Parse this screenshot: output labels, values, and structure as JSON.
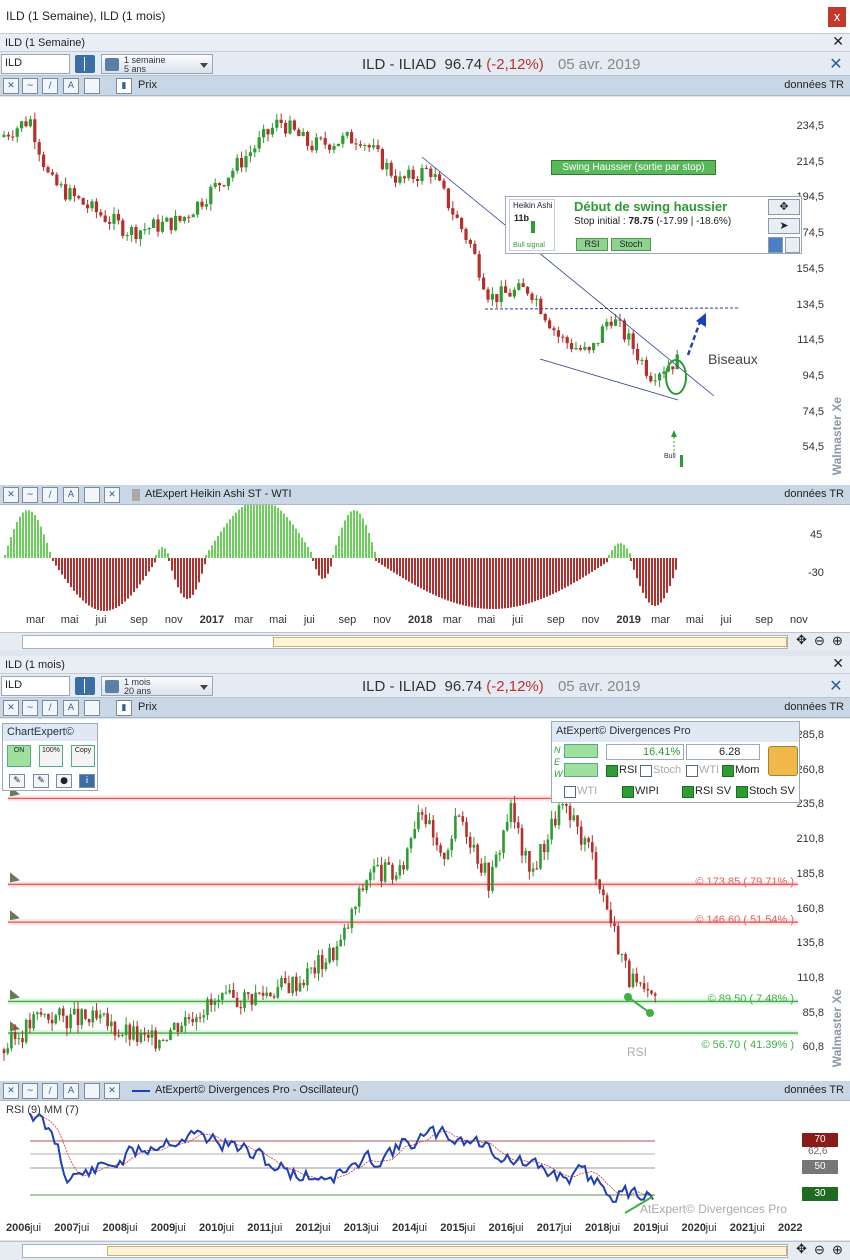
{
  "window": {
    "title": "ILD (1 Semaine), ILD (1 mois)",
    "close": "x"
  },
  "pane1": {
    "header": "ILD (1 Semaine)",
    "close": "✕",
    "symbol": "ILD",
    "period_line1": "1 semaine",
    "period_line2": "5 ans",
    "title_name": "ILD - ILIAD",
    "title_price": "96.74",
    "title_change": "(-2,12%)",
    "title_date": "05 avr. 2019",
    "toolbar_label": "Prix",
    "toolbar_right": "données TR",
    "y_ticks": [
      "234,5",
      "214,5",
      "194,5",
      "174,5",
      "154,5",
      "134,5",
      "114,5",
      "94,5",
      "74,5",
      "54,5"
    ],
    "watermark": "Walmaster Xe",
    "annotation_biseaux": "Biseaux",
    "bull_label": "Bull",
    "swing": {
      "box_label": "Heikin Ashi",
      "box_count": "11b",
      "box_signal": "Bull signal",
      "heading": "Début de swing haussier",
      "stop_prefix": "Stop initial :",
      "stop_value": "78.75",
      "stop_detail": "(-17.99 | -18.6%)",
      "btn_rsi": "RSI",
      "btn_stoch": "Stoch",
      "status": "Swing Haussier (sortie par stop)"
    },
    "sub": {
      "label": "AtExpert Heikin Ashi ST - WTI",
      "right": "données TR",
      "y_ticks": [
        "45",
        "-30"
      ]
    },
    "x_labels": [
      "mar",
      "mai",
      "jui",
      "sep",
      "nov",
      "2017",
      "mar",
      "mai",
      "jui",
      "sep",
      "nov",
      "2018",
      "mar",
      "mai",
      "jui",
      "sep",
      "nov",
      "2019",
      "mar",
      "mai",
      "jui",
      "sep",
      "nov"
    ]
  },
  "pane2": {
    "header": "ILD (1 mois)",
    "close": "✕",
    "symbol": "ILD",
    "period_line1": "1 mois",
    "period_line2": "20 ans",
    "title_name": "ILD - ILIAD",
    "title_price": "96.74",
    "title_change": "(-2,12%)",
    "title_date": "05 avr. 2019",
    "toolbar_label": "Prix",
    "toolbar_right": "données TR",
    "y_ticks": [
      "285,8",
      "260,8",
      "235,8",
      "210,8",
      "185,8",
      "160,8",
      "135,8",
      "110,8",
      "85,8",
      "60,8"
    ],
    "watermark": "Walmaster Xe",
    "chartexpert": {
      "title": "ChartExpert©",
      "b1": "ON",
      "b2": "100%",
      "b3": "Copy"
    },
    "divergences": {
      "title": "AtExpert© Divergences Pro",
      "rows": [
        "N",
        "E",
        "W"
      ],
      "pct": "16.41%",
      "rr": "6.28",
      "rsi": "RSI",
      "stoch": "Stoch",
      "wti": "WTI",
      "mom": "Mom",
      "wti2": "WTI",
      "wipi": "WIPI",
      "rsisv": "RSI SV",
      "stochsv": "Stoch SV"
    },
    "fib": [
      "© 173.85 ( 79.71% )",
      "© 146.60 ( 51.54% )",
      "© 89.50 ( 7.48% )",
      "© 56.70 ( 41.39% )"
    ],
    "rsi_tag": "RSI",
    "osc": {
      "label": "AtExpert© Divergences Pro - Oscillateur()",
      "right": "données TR",
      "sub": "RSI (9) MM (7)",
      "levels": [
        "70",
        "62,6",
        "50",
        "30"
      ],
      "watermark": "AtExpert© Divergences Pro"
    },
    "x_labels": [
      "2006",
      "jui",
      "2007",
      "jui",
      "2008",
      "jui",
      "2009",
      "jui",
      "2010",
      "jui",
      "2011",
      "jui",
      "2012",
      "jui",
      "2013",
      "jui",
      "2014",
      "jui",
      "2015",
      "jui",
      "2016",
      "jui",
      "2017",
      "jui",
      "2018",
      "jui",
      "2019",
      "jui",
      "2020",
      "jui",
      "2021",
      "jui",
      "2022"
    ]
  },
  "colors": {
    "up": "#2e9b33",
    "down": "#b5302c",
    "fib_red": "#e85c5c",
    "fib_green": "#3cb043"
  }
}
